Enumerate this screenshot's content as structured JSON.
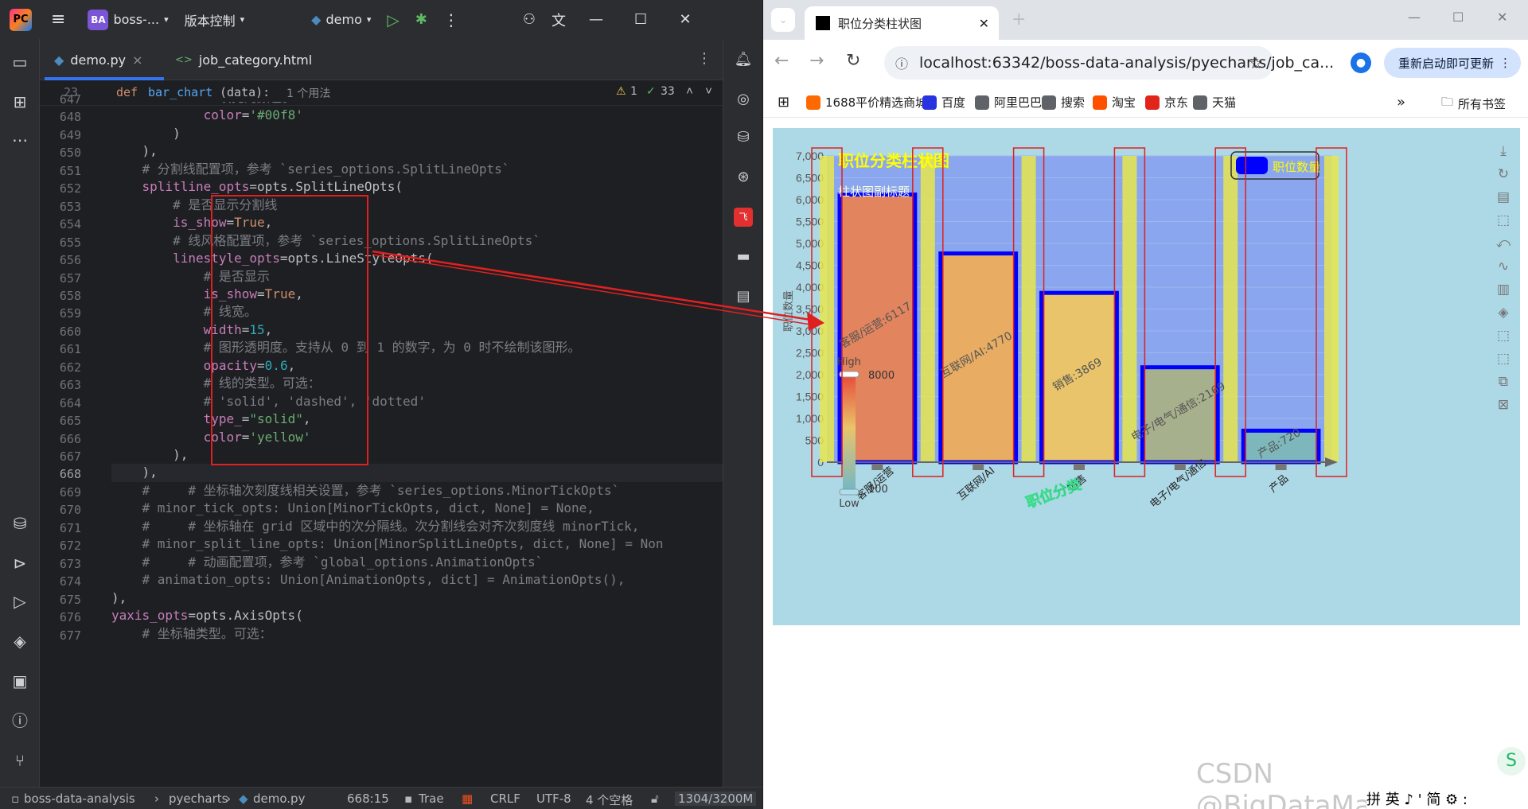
{
  "ide": {
    "project_badge": "BA",
    "project_name": "boss-...",
    "vcs_label": "版本控制",
    "run_config": "demo",
    "tabs": [
      {
        "label": "demo.py",
        "active": true,
        "close": "×"
      },
      {
        "label": "job_category.html",
        "active": false
      }
    ],
    "breadcrumb": {
      "line": "23",
      "signature_kw": "def",
      "signature_fn": "bar_chart",
      "signature_rest": "(data):",
      "usages": "1 个用法",
      "warnings": "1",
      "checks": "33"
    },
    "code_lines": [
      {
        "num": "647",
        "html": "<span class='c'>            # 填充的颜色。</span>"
      },
      {
        "num": "648",
        "html": "            <span class='p'>color</span>=<span class='s'>'#00f8'</span>"
      },
      {
        "num": "649",
        "html": "        )"
      },
      {
        "num": "650",
        "html": "    ),"
      },
      {
        "num": "651",
        "html": "<span class='c'>    # 分割线配置项，参考 `series_options.SplitLineOpts`</span>"
      },
      {
        "num": "652",
        "html": "    <span class='p'>splitline_opts</span>=opts.SplitLineOpts("
      },
      {
        "num": "653",
        "html": "<span class='c'>        # 是否显示分割线</span>"
      },
      {
        "num": "654",
        "html": "        <span class='p'>is_show</span>=<span class='k'>True</span>,"
      },
      {
        "num": "655",
        "html": "<span class='c'>        # 线风格配置项，参考 `series_options.SplitLineOpts`</span>"
      },
      {
        "num": "656",
        "html": "        <span class='p'>linestyle_opts</span>=opts.LineStyleOpts("
      },
      {
        "num": "657",
        "html": "<span class='c'>            # 是否显示</span>"
      },
      {
        "num": "658",
        "html": "            <span class='p'>is_show</span>=<span class='k'>True</span>,"
      },
      {
        "num": "659",
        "html": "<span class='c'>            # 线宽。</span>"
      },
      {
        "num": "660",
        "html": "            <span class='p'>width</span>=<span class='n'>15</span>,"
      },
      {
        "num": "661",
        "html": "<span class='c'>            # 图形透明度。支持从 0 到 1 的数字，为 0 时不绘制该图形。</span>"
      },
      {
        "num": "662",
        "html": "            <span class='p'>opacity</span>=<span class='n'>0.6</span>,"
      },
      {
        "num": "663",
        "html": "<span class='c'>            # 线的类型。可选：</span>"
      },
      {
        "num": "664",
        "html": "<span class='c'>            # 'solid', 'dashed', 'dotted'</span>"
      },
      {
        "num": "665",
        "html": "            <span class='p'>type_</span>=<span class='s'>\"solid\"</span>,"
      },
      {
        "num": "666",
        "html": "            <span class='p'>color</span>=<span class='s'>'yellow'</span>"
      },
      {
        "num": "667",
        "html": "        ),"
      },
      {
        "num": "668",
        "html": "    ),"
      },
      {
        "num": "669",
        "html": "<span class='c'>    #     # 坐标轴次刻度线相关设置，参考 `series_options.MinorTickOpts`</span>"
      },
      {
        "num": "670",
        "html": "<span class='c'>    # minor_tick_opts: Union[MinorTickOpts, dict, None] = None,</span>"
      },
      {
        "num": "671",
        "html": "<span class='c'>    #     # 坐标轴在 grid 区域中的次分隔线。次分割线会对齐次刻度线 minorTick,</span>"
      },
      {
        "num": "672",
        "html": "<span class='c'>    # minor_split_line_opts: Union[MinorSplitLineOpts, dict, None] = Non</span>"
      },
      {
        "num": "673",
        "html": "<span class='c'>    #     # 动画配置项，参考 `global_options.AnimationOpts`</span>"
      },
      {
        "num": "674",
        "html": "<span class='c'>    # animation_opts: Union[AnimationOpts, dict] = AnimationOpts(),</span>"
      },
      {
        "num": "675",
        "html": "),"
      },
      {
        "num": "676",
        "html": "<span class='p'>yaxis_opts</span>=opts.AxisOpts("
      },
      {
        "num": "677",
        "html": "<span class='c'>    # 坐标轴类型。可选：</span>"
      }
    ],
    "current_line": "668",
    "status": {
      "project": "boss-data-analysis",
      "folder": "pyecharts",
      "file": "demo.py",
      "position": "668:15",
      "plugin": "Trae",
      "line_sep": "CRLF",
      "encoding": "UTF-8",
      "indent": "4 个空格",
      "memory": "1304/3200M"
    }
  },
  "browser": {
    "tab_title": "职位分类柱状图",
    "url": "localhost:63342/boss-data-analysis/pyecharts/job_ca...",
    "restart_label": "重新启动即可更新",
    "bookmarks": [
      {
        "label": "1688平价精选商城",
        "color": "#ff6a00"
      },
      {
        "label": "百度",
        "color": "#2932e1"
      },
      {
        "label": "阿里巴巴",
        "color": "#5f6368"
      },
      {
        "label": "搜索",
        "color": "#5f6368"
      },
      {
        "label": "淘宝",
        "color": "#ff5000"
      },
      {
        "label": "京东",
        "color": "#e1251b"
      },
      {
        "label": "天猫",
        "color": "#5f6368"
      }
    ],
    "all_bookmarks": "所有书签"
  },
  "chart_data": {
    "type": "bar",
    "title": "职位分类柱状图",
    "subtitle": "柱状图副标题",
    "xlabel": "职位分类",
    "ylabel": "职位数量",
    "legend": "职位数量",
    "legend_position": "top-right",
    "categories": [
      "客服/运营",
      "互联网/AI",
      "销售",
      "电子/电气/通信",
      "产品"
    ],
    "series": [
      {
        "name": "职位数量",
        "values": [
          6117,
          4770,
          3869,
          2169,
          720
        ]
      }
    ],
    "bar_labels": [
      "客服/运营:6117",
      "互联网/AI:4770",
      "销售:3869",
      "电子/电气/通信:2169",
      "产品:720"
    ],
    "y_ticks": [
      "0",
      "500",
      "1,000",
      "1,500",
      "2,000",
      "2,500",
      "3,000",
      "3,500",
      "4,000",
      "4,500",
      "5,000",
      "5,500",
      "6,000",
      "6,500",
      "7,000"
    ],
    "ylim": [
      0,
      7000
    ],
    "grid": true,
    "visual_map": {
      "high_label": "High",
      "low_label": "Low",
      "max": "8000",
      "min": "100"
    },
    "colors": {
      "background": "#add8e6",
      "plot_area": "#8aa6ee",
      "bar_border": "#0000ff",
      "split_line": "#e6e64d",
      "legend_swatch": "#0000ff",
      "title": "#ffff00"
    }
  },
  "watermark": "CSDN @BigDataMagician",
  "ime_text": "拼 英 ♪ ' 简 ⚙ :"
}
